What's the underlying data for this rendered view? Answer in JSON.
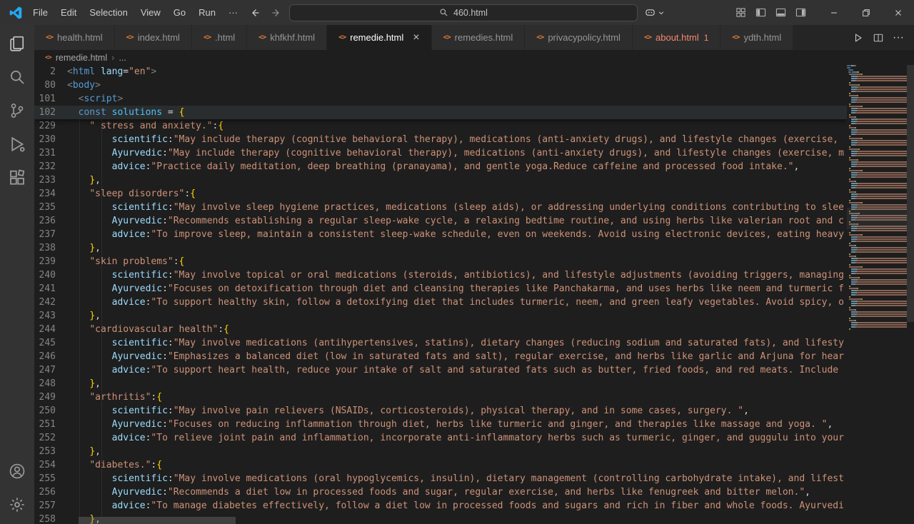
{
  "titlebar": {
    "menus": [
      "File",
      "Edit",
      "Selection",
      "View",
      "Go",
      "Run",
      "···"
    ],
    "search_value": "460.html",
    "icons": [
      "vscode-logo",
      "back-arrow-icon",
      "forward-arrow-icon",
      "search-icon",
      "copilot-icon",
      "chevron-down-icon",
      "customize-layout-icon",
      "toggle-primary-sidebar-icon",
      "toggle-panel-icon",
      "toggle-secondary-sidebar-icon",
      "minimize-icon",
      "restore-icon",
      "close-icon"
    ]
  },
  "tabs": [
    {
      "label": "health.html"
    },
    {
      "label": "index.html"
    },
    {
      "label": ".html"
    },
    {
      "label": "khfkhf.html"
    },
    {
      "label": "remedie.html",
      "active": true
    },
    {
      "label": "remedies.html"
    },
    {
      "label": "privacypolicy.html"
    },
    {
      "label": "about.html",
      "error": true,
      "badge": "1"
    },
    {
      "label": "ydth.html"
    }
  ],
  "tab_actions": [
    {
      "icon": "run-icon"
    },
    {
      "icon": "split-editor-icon"
    },
    {
      "icon": "more-actions-icon"
    }
  ],
  "breadcrumb": {
    "file": "remedie.html",
    "more": "..."
  },
  "activity_bar": {
    "top": [
      "explorer",
      "search",
      "source-control",
      "run-and-debug",
      "extensions"
    ],
    "bottom": [
      "accounts",
      "settings"
    ]
  },
  "editor": {
    "sticky_lines": [
      {
        "n": 2,
        "t": [
          [
            "g",
            "<"
          ],
          [
            "t",
            "html"
          ],
          [
            "p",
            " "
          ],
          [
            "a",
            "lang"
          ],
          [
            "p",
            "="
          ],
          [
            "s",
            "\"en\""
          ],
          [
            "g",
            ">"
          ]
        ]
      },
      {
        "n": 80,
        "t": [
          [
            "g",
            "<"
          ],
          [
            "t",
            "body"
          ],
          [
            "g",
            ">"
          ]
        ]
      },
      {
        "n": 101,
        "t": [
          [
            "p",
            "  "
          ],
          [
            "g",
            "<"
          ],
          [
            "t",
            "script"
          ],
          [
            "g",
            ">"
          ]
        ]
      },
      {
        "n": 102,
        "hl": true,
        "t": [
          [
            "p",
            "  "
          ],
          [
            "k",
            "const"
          ],
          [
            "p",
            " "
          ],
          [
            "v",
            "solutions"
          ],
          [
            "p",
            " = "
          ],
          [
            "b",
            "{"
          ]
        ]
      }
    ],
    "lines": [
      {
        "n": 229,
        "t": [
          [
            "p",
            "    "
          ],
          [
            "s",
            "\" stress and anxiety.\""
          ],
          [
            "p",
            ":"
          ],
          [
            "b",
            "{"
          ]
        ]
      },
      {
        "n": 230,
        "t": [
          [
            "p",
            "        "
          ],
          [
            "o",
            "scientific"
          ],
          [
            "p",
            ":"
          ],
          [
            "s",
            "\"May include therapy (cognitive behavioral therapy), medications (anti-anxiety drugs), and lifestyle changes (exercise, "
          ]
        ]
      },
      {
        "n": 231,
        "t": [
          [
            "p",
            "        "
          ],
          [
            "o",
            "Ayurvedic"
          ],
          [
            "p",
            ":"
          ],
          [
            "s",
            "\"May include therapy (cognitive behavioral therapy), medications (anti-anxiety drugs), and lifestyle changes (exercise, m"
          ]
        ]
      },
      {
        "n": 232,
        "t": [
          [
            "p",
            "        "
          ],
          [
            "o",
            "advice"
          ],
          [
            "p",
            ":"
          ],
          [
            "s",
            "\"Practice daily meditation, deep breathing (pranayama), and gentle yoga.Reduce caffeine and processed food intake.\""
          ],
          [
            "p",
            ","
          ]
        ]
      },
      {
        "n": 233,
        "t": [
          [
            "p",
            "    "
          ],
          [
            "b",
            "}"
          ],
          [
            "p",
            ","
          ]
        ]
      },
      {
        "n": 234,
        "t": [
          [
            "p",
            "    "
          ],
          [
            "s",
            "\"sleep disorders\""
          ],
          [
            "p",
            ":"
          ],
          [
            "b",
            "{"
          ]
        ]
      },
      {
        "n": 235,
        "t": [
          [
            "p",
            "        "
          ],
          [
            "o",
            "scientific"
          ],
          [
            "p",
            ":"
          ],
          [
            "s",
            "\"May involve sleep hygiene practices, medications (sleep aids), or addressing underlying conditions contributing to slee"
          ]
        ]
      },
      {
        "n": 236,
        "t": [
          [
            "p",
            "        "
          ],
          [
            "o",
            "Ayurvedic"
          ],
          [
            "p",
            ":"
          ],
          [
            "s",
            "\"Recommends establishing a regular sleep-wake cycle, a relaxing bedtime routine, and using herbs like valerian root and c"
          ]
        ]
      },
      {
        "n": 237,
        "t": [
          [
            "p",
            "        "
          ],
          [
            "o",
            "advice"
          ],
          [
            "p",
            ":"
          ],
          [
            "s",
            "\"To improve sleep, maintain a consistent sleep-wake schedule, even on weekends. Avoid using electronic devices, eating heavy"
          ]
        ]
      },
      {
        "n": 238,
        "t": [
          [
            "p",
            "    "
          ],
          [
            "b",
            "}"
          ],
          [
            "p",
            ","
          ]
        ]
      },
      {
        "n": 239,
        "t": [
          [
            "p",
            "    "
          ],
          [
            "s",
            "\"skin problems\""
          ],
          [
            "p",
            ":"
          ],
          [
            "b",
            "{"
          ]
        ]
      },
      {
        "n": 240,
        "t": [
          [
            "p",
            "        "
          ],
          [
            "o",
            "scientific"
          ],
          [
            "p",
            ":"
          ],
          [
            "s",
            "\"May involve topical or oral medications (steroids, antibiotics), and lifestyle adjustments (avoiding triggers, managing"
          ]
        ]
      },
      {
        "n": 241,
        "t": [
          [
            "p",
            "        "
          ],
          [
            "o",
            "Ayurvedic"
          ],
          [
            "p",
            ":"
          ],
          [
            "s",
            "\"Focuses on detoxification through diet and cleansing therapies like Panchakarma, and uses herbs like neem and turmeric f"
          ]
        ]
      },
      {
        "n": 242,
        "t": [
          [
            "p",
            "        "
          ],
          [
            "o",
            "advice"
          ],
          [
            "p",
            ":"
          ],
          [
            "s",
            "\"To support healthy skin, follow a detoxifying diet that includes turmeric, neem, and green leafy vegetables. Avoid spicy, o"
          ]
        ]
      },
      {
        "n": 243,
        "t": [
          [
            "p",
            "    "
          ],
          [
            "b",
            "}"
          ],
          [
            "p",
            ","
          ]
        ]
      },
      {
        "n": 244,
        "t": [
          [
            "p",
            "    "
          ],
          [
            "s",
            "\"cardiovascular health\""
          ],
          [
            "p",
            ":"
          ],
          [
            "b",
            "{"
          ]
        ]
      },
      {
        "n": 245,
        "t": [
          [
            "p",
            "        "
          ],
          [
            "o",
            "scientific"
          ],
          [
            "p",
            ":"
          ],
          [
            "s",
            "\"May involve medications (antihypertensives, statins), dietary changes (reducing sodium and saturated fats), and lifesty"
          ]
        ]
      },
      {
        "n": 246,
        "t": [
          [
            "p",
            "        "
          ],
          [
            "o",
            "Ayurvedic"
          ],
          [
            "p",
            ":"
          ],
          [
            "s",
            "\"Emphasizes a balanced diet (low in saturated fats and salt), regular exercise, and herbs like garlic and Arjuna for hear"
          ]
        ]
      },
      {
        "n": 247,
        "t": [
          [
            "p",
            "        "
          ],
          [
            "o",
            "advice"
          ],
          [
            "p",
            ":"
          ],
          [
            "s",
            "\"To support heart health, reduce your intake of salt and saturated fats such as butter, fried foods, and red meats. Include "
          ]
        ]
      },
      {
        "n": 248,
        "t": [
          [
            "p",
            "    "
          ],
          [
            "b",
            "}"
          ],
          [
            "p",
            ","
          ]
        ]
      },
      {
        "n": 249,
        "t": [
          [
            "p",
            "    "
          ],
          [
            "s",
            "\"arthritis\""
          ],
          [
            "p",
            ":"
          ],
          [
            "b",
            "{"
          ]
        ]
      },
      {
        "n": 250,
        "t": [
          [
            "p",
            "        "
          ],
          [
            "o",
            "scientific"
          ],
          [
            "p",
            ":"
          ],
          [
            "s",
            "\"May involve pain relievers (NSAIDs, corticosteroids), physical therapy, and in some cases, surgery. \""
          ],
          [
            "p",
            ","
          ]
        ]
      },
      {
        "n": 251,
        "t": [
          [
            "p",
            "        "
          ],
          [
            "o",
            "Ayurvedic"
          ],
          [
            "p",
            ":"
          ],
          [
            "s",
            "\"Focuses on reducing inflammation through diet, herbs like turmeric and ginger, and therapies like massage and yoga. \""
          ],
          [
            "p",
            ","
          ]
        ]
      },
      {
        "n": 252,
        "t": [
          [
            "p",
            "        "
          ],
          [
            "o",
            "advice"
          ],
          [
            "p",
            ":"
          ],
          [
            "s",
            "\"To relieve joint pain and inflammation, incorporate anti-inflammatory herbs such as turmeric, ginger, and guggulu into your"
          ]
        ]
      },
      {
        "n": 253,
        "t": [
          [
            "p",
            "    "
          ],
          [
            "b",
            "}"
          ],
          [
            "p",
            ","
          ]
        ]
      },
      {
        "n": 254,
        "t": [
          [
            "p",
            "    "
          ],
          [
            "s",
            "\"diabetes.\""
          ],
          [
            "p",
            ":"
          ],
          [
            "b",
            "{"
          ]
        ]
      },
      {
        "n": 255,
        "t": [
          [
            "p",
            "        "
          ],
          [
            "o",
            "scientific"
          ],
          [
            "p",
            ":"
          ],
          [
            "s",
            "\"May involve medications (oral hypoglycemics, insulin), dietary management (controlling carbohydrate intake), and lifest"
          ]
        ]
      },
      {
        "n": 256,
        "t": [
          [
            "p",
            "        "
          ],
          [
            "o",
            "Ayurvedic"
          ],
          [
            "p",
            ":"
          ],
          [
            "s",
            "\"Recommends a diet low in processed foods and sugar, regular exercise, and herbs like fenugreek and bitter melon.\""
          ],
          [
            "p",
            ","
          ]
        ]
      },
      {
        "n": 257,
        "t": [
          [
            "p",
            "        "
          ],
          [
            "o",
            "advice"
          ],
          [
            "p",
            ":"
          ],
          [
            "s",
            "\"To manage diabetes effectively, follow a diet low in processed foods and sugars and rich in fiber and whole foods. Ayurvedi"
          ]
        ]
      },
      {
        "n": 258,
        "t": [
          [
            "p",
            "    "
          ],
          [
            "b",
            "}"
          ],
          [
            "p",
            ","
          ]
        ]
      }
    ]
  }
}
